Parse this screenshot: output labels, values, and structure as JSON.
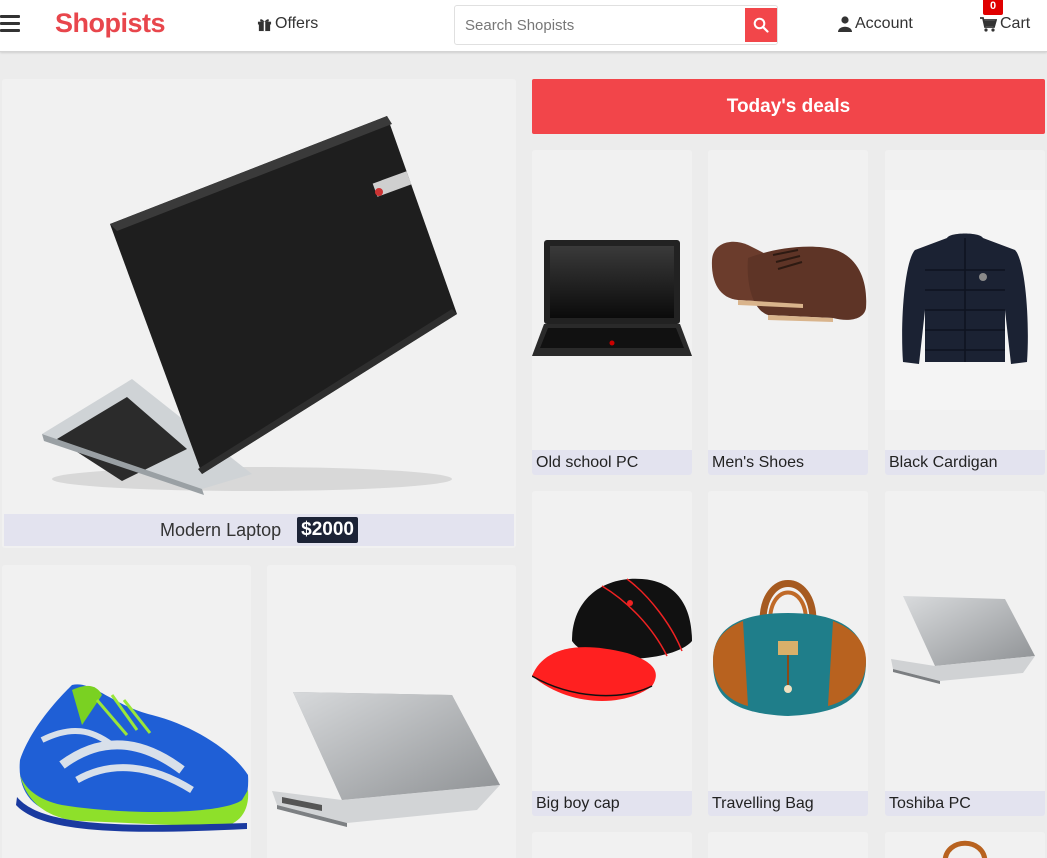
{
  "header": {
    "menu_icon": "hamburger-menu-icon",
    "logo": "Shopists",
    "offers_label": "Offers",
    "offers_icon": "gift-icon",
    "search_placeholder": "Search Shopists",
    "search_icon": "search-icon",
    "account_label": "Account",
    "account_icon": "user-icon",
    "cart_label": "Cart",
    "cart_icon": "cart-icon",
    "cart_count": "0"
  },
  "featured": {
    "name": "Modern Laptop",
    "price": "$2000"
  },
  "deals": {
    "title": "Today's deals",
    "items": [
      {
        "label": "Old school PC"
      },
      {
        "label": "Men's Shoes"
      },
      {
        "label": "Black Cardigan"
      },
      {
        "label": "Big boy cap"
      },
      {
        "label": "Travelling Bag"
      },
      {
        "label": "Toshiba PC"
      }
    ]
  },
  "colors": {
    "brand": "#e8464c",
    "banner": "#f2454a",
    "caption_bg": "#e3e3ef",
    "price_bg": "#1c2336",
    "badge": "#e00000"
  }
}
